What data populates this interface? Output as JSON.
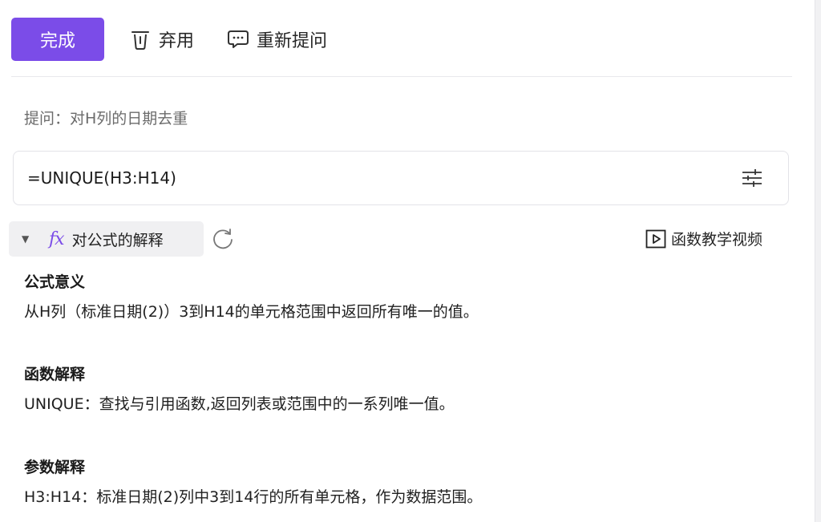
{
  "toolbar": {
    "done_label": "完成",
    "discard_label": "弃用",
    "reask_label": "重新提问"
  },
  "question": {
    "text": "提问：对H列的日期去重"
  },
  "formula": {
    "text": "=UNIQUE(H3:H14)"
  },
  "explain": {
    "toggle_label": "对公式的解释",
    "fx_symbol": "fx",
    "video_label": "函数教学视频"
  },
  "sections": [
    {
      "title": "公式意义",
      "body": "从H列（标准日期(2)）3到H14的单元格范围中返回所有唯一的值。"
    },
    {
      "title": "函数解释",
      "body": "UNIQUE：查找与引用函数,返回列表或范围中的一系列唯一值。"
    },
    {
      "title": "参数解释",
      "body": "H3:H14：标准日期(2)列中3到14行的所有单元格，作为数据范围。"
    }
  ],
  "colors": {
    "accent": "#7b4ce8",
    "toggle_bg": "#f0f0f2"
  },
  "icons": {
    "discard": "trash-icon",
    "reask": "chat-icon",
    "settings": "sliders-icon",
    "refresh": "refresh-icon",
    "video": "play-icon",
    "caret": "caret-down-icon"
  }
}
